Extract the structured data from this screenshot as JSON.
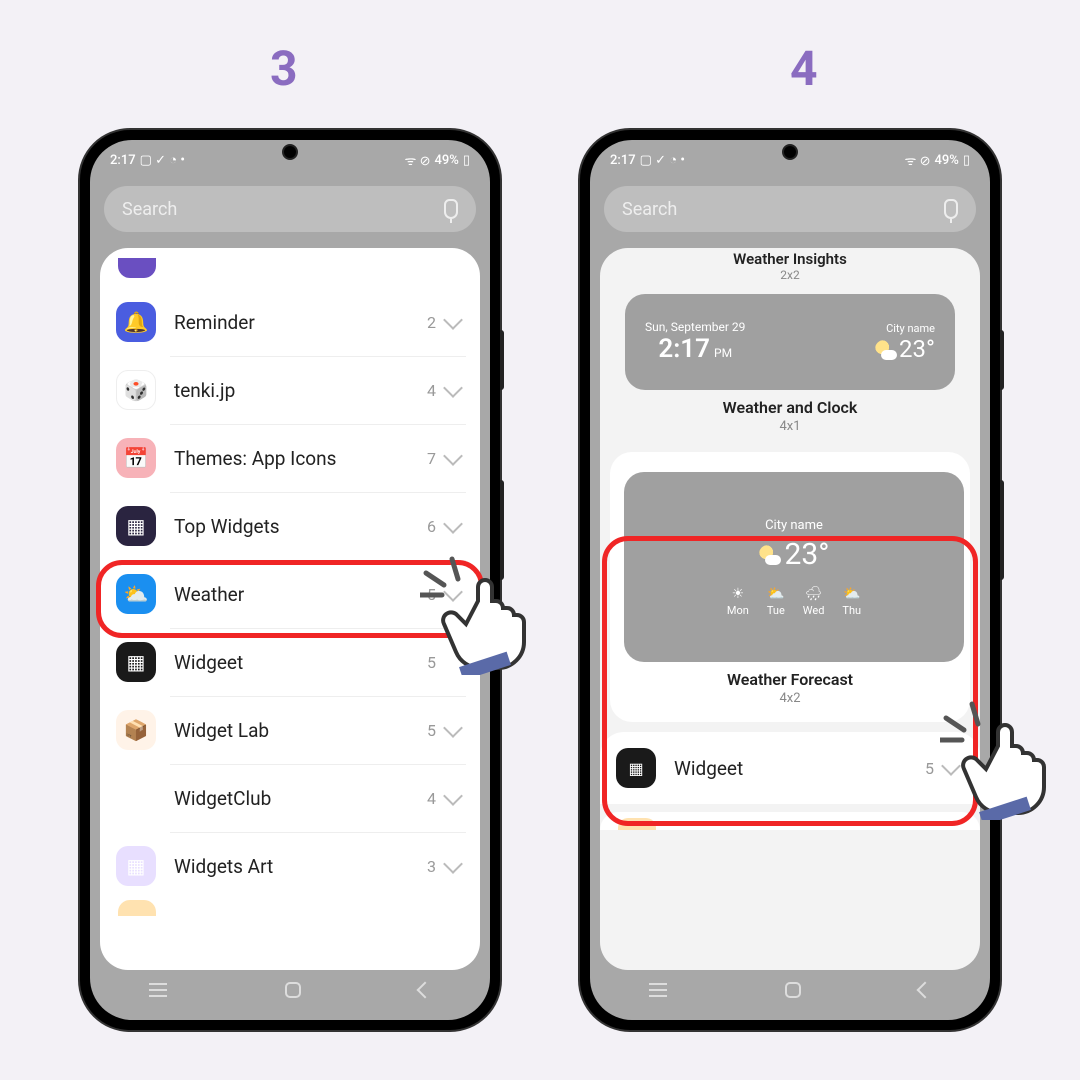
{
  "steps": {
    "left": "3",
    "right": "4"
  },
  "status": {
    "time": "2:17",
    "battery": "49%",
    "icons_left": "▢ ✓ ◔ •",
    "icons_right": "ᯤ ⊘"
  },
  "search": {
    "placeholder": "Search"
  },
  "left_list": [
    {
      "name": "reminder",
      "label": "Reminder",
      "count": "2",
      "chevron": true,
      "icon_class": "ic-reminder",
      "glyph": "🔔"
    },
    {
      "name": "tenki",
      "label": "tenki.jp",
      "count": "4",
      "chevron": true,
      "icon_class": "ic-tenki",
      "glyph": "🎲"
    },
    {
      "name": "themes",
      "label": "Themes: App Icons",
      "count": "7",
      "chevron": true,
      "icon_class": "ic-themes",
      "glyph": "📅"
    },
    {
      "name": "top-widgets",
      "label": "Top Widgets",
      "count": "6",
      "chevron": true,
      "icon_class": "ic-top",
      "glyph": "▦"
    },
    {
      "name": "weather",
      "label": "Weather",
      "count": "5",
      "chevron": true,
      "icon_class": "ic-weather",
      "glyph": "⛅"
    },
    {
      "name": "widgeet",
      "label": "Widgeet",
      "count": "5",
      "chevron": false,
      "icon_class": "ic-widgeet",
      "glyph": "▦"
    },
    {
      "name": "widget-lab",
      "label": "Widget Lab",
      "count": "5",
      "chevron": true,
      "icon_class": "ic-lab",
      "glyph": "📦"
    },
    {
      "name": "widgetclub",
      "label": "WidgetClub",
      "count": "4",
      "chevron": true,
      "icon_class": "ic-club",
      "glyph": "▦"
    },
    {
      "name": "widgets-art",
      "label": "Widgets Art",
      "count": "3",
      "chevron": true,
      "icon_class": "ic-art",
      "glyph": "▦"
    }
  ],
  "right_panel": {
    "peek_title": "Weather Insights",
    "peek_size": "2x2",
    "clock_widget": {
      "date": "Sun, September 29",
      "time": "2:17",
      "ampm": "PM",
      "city": "City name",
      "temp": "23°",
      "title": "Weather and Clock",
      "size": "4x1"
    },
    "forecast_widget": {
      "city": "City name",
      "temp": "23°",
      "days": [
        {
          "icon": "☀",
          "label": "Mon"
        },
        {
          "icon": "⛅",
          "label": "Tue"
        },
        {
          "icon": "🌧",
          "label": "Wed"
        },
        {
          "icon": "⛅",
          "label": "Thu"
        }
      ],
      "title": "Weather Forecast",
      "size": "4x2"
    },
    "next_row": {
      "label": "Widgeet",
      "count": "5",
      "icon_class": "ic-widgeet",
      "glyph": "▦"
    }
  }
}
